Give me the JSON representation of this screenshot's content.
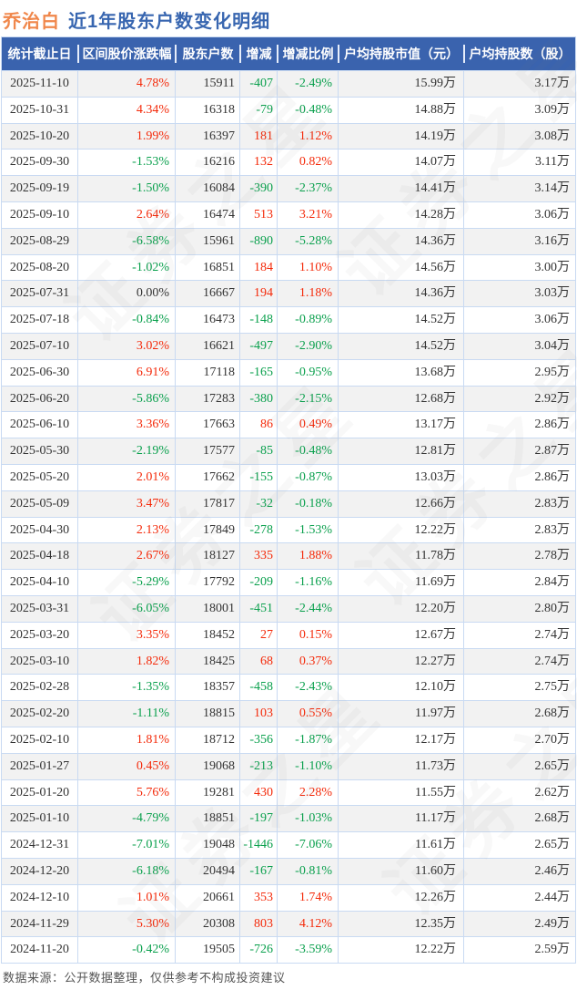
{
  "page": {
    "title_stock": "乔治白",
    "title_text": "近1年股东户数变化明细",
    "footer": "数据来源：公开数据整理，仅供参考不构成投资建议",
    "watermark": "证券之星"
  },
  "colors": {
    "up": "#f42a0a",
    "down": "#0aa04d",
    "flat": "#333333",
    "header_bg": "#3a63ae",
    "title_stock": "#f0874b",
    "title_text": "#3866b0",
    "border": "#c9daf2",
    "row_alt": "#f2f2f2"
  },
  "chart_data": {
    "type": "table",
    "title": "乔治白 近1年股东户数变化明细",
    "columns": [
      "统计截止日",
      "区间股价涨跌幅",
      "股东户数",
      "增减",
      "增减比例",
      "户均持股市值（元）",
      "户均持股数（股）"
    ],
    "rows": [
      [
        "2025-11-10",
        "4.78%",
        "15911",
        "-407",
        "-2.49%",
        "15.99万",
        "3.17万"
      ],
      [
        "2025-10-31",
        "4.34%",
        "16318",
        "-79",
        "-0.48%",
        "14.88万",
        "3.09万"
      ],
      [
        "2025-10-20",
        "1.99%",
        "16397",
        "181",
        "1.12%",
        "14.19万",
        "3.08万"
      ],
      [
        "2025-09-30",
        "-1.53%",
        "16216",
        "132",
        "0.82%",
        "14.07万",
        "3.11万"
      ],
      [
        "2025-09-19",
        "-1.50%",
        "16084",
        "-390",
        "-2.37%",
        "14.41万",
        "3.14万"
      ],
      [
        "2025-09-10",
        "2.64%",
        "16474",
        "513",
        "3.21%",
        "14.28万",
        "3.06万"
      ],
      [
        "2025-08-29",
        "-6.58%",
        "15961",
        "-890",
        "-5.28%",
        "14.36万",
        "3.16万"
      ],
      [
        "2025-08-20",
        "-1.02%",
        "16851",
        "184",
        "1.10%",
        "14.56万",
        "3.00万"
      ],
      [
        "2025-07-31",
        "0.00%",
        "16667",
        "194",
        "1.18%",
        "14.36万",
        "3.03万"
      ],
      [
        "2025-07-18",
        "-0.84%",
        "16473",
        "-148",
        "-0.89%",
        "14.52万",
        "3.06万"
      ],
      [
        "2025-07-10",
        "3.02%",
        "16621",
        "-497",
        "-2.90%",
        "14.52万",
        "3.04万"
      ],
      [
        "2025-06-30",
        "6.91%",
        "17118",
        "-165",
        "-0.95%",
        "13.68万",
        "2.95万"
      ],
      [
        "2025-06-20",
        "-5.86%",
        "17283",
        "-380",
        "-2.15%",
        "12.68万",
        "2.92万"
      ],
      [
        "2025-06-10",
        "3.36%",
        "17663",
        "86",
        "0.49%",
        "13.17万",
        "2.86万"
      ],
      [
        "2025-05-30",
        "-2.19%",
        "17577",
        "-85",
        "-0.48%",
        "12.81万",
        "2.87万"
      ],
      [
        "2025-05-20",
        "2.01%",
        "17662",
        "-155",
        "-0.87%",
        "13.03万",
        "2.86万"
      ],
      [
        "2025-05-09",
        "3.47%",
        "17817",
        "-32",
        "-0.18%",
        "12.66万",
        "2.83万"
      ],
      [
        "2025-04-30",
        "2.13%",
        "17849",
        "-278",
        "-1.53%",
        "12.22万",
        "2.83万"
      ],
      [
        "2025-04-18",
        "2.67%",
        "18127",
        "335",
        "1.88%",
        "11.78万",
        "2.78万"
      ],
      [
        "2025-04-10",
        "-5.29%",
        "17792",
        "-209",
        "-1.16%",
        "11.69万",
        "2.84万"
      ],
      [
        "2025-03-31",
        "-6.05%",
        "18001",
        "-451",
        "-2.44%",
        "12.20万",
        "2.80万"
      ],
      [
        "2025-03-20",
        "3.35%",
        "18452",
        "27",
        "0.15%",
        "12.67万",
        "2.74万"
      ],
      [
        "2025-03-10",
        "1.82%",
        "18425",
        "68",
        "0.37%",
        "12.27万",
        "2.74万"
      ],
      [
        "2025-02-28",
        "-1.35%",
        "18357",
        "-458",
        "-2.43%",
        "12.10万",
        "2.75万"
      ],
      [
        "2025-02-20",
        "-1.11%",
        "18815",
        "103",
        "0.55%",
        "11.97万",
        "2.68万"
      ],
      [
        "2025-02-10",
        "1.81%",
        "18712",
        "-356",
        "-1.87%",
        "12.17万",
        "2.70万"
      ],
      [
        "2025-01-27",
        "0.45%",
        "19068",
        "-213",
        "-1.10%",
        "11.73万",
        "2.65万"
      ],
      [
        "2025-01-20",
        "5.76%",
        "19281",
        "430",
        "2.28%",
        "11.55万",
        "2.62万"
      ],
      [
        "2025-01-10",
        "-4.79%",
        "18851",
        "-197",
        "-1.03%",
        "11.17万",
        "2.68万"
      ],
      [
        "2024-12-31",
        "-7.01%",
        "19048",
        "-1446",
        "-7.06%",
        "11.61万",
        "2.65万"
      ],
      [
        "2024-12-20",
        "-6.18%",
        "20494",
        "-167",
        "-0.81%",
        "11.60万",
        "2.46万"
      ],
      [
        "2024-12-10",
        "1.01%",
        "20661",
        "353",
        "1.74%",
        "12.26万",
        "2.44万"
      ],
      [
        "2024-11-29",
        "5.30%",
        "20308",
        "803",
        "4.12%",
        "12.35万",
        "2.49万"
      ],
      [
        "2024-11-20",
        "-0.42%",
        "19505",
        "-726",
        "-3.59%",
        "12.22万",
        "2.59万"
      ]
    ]
  }
}
